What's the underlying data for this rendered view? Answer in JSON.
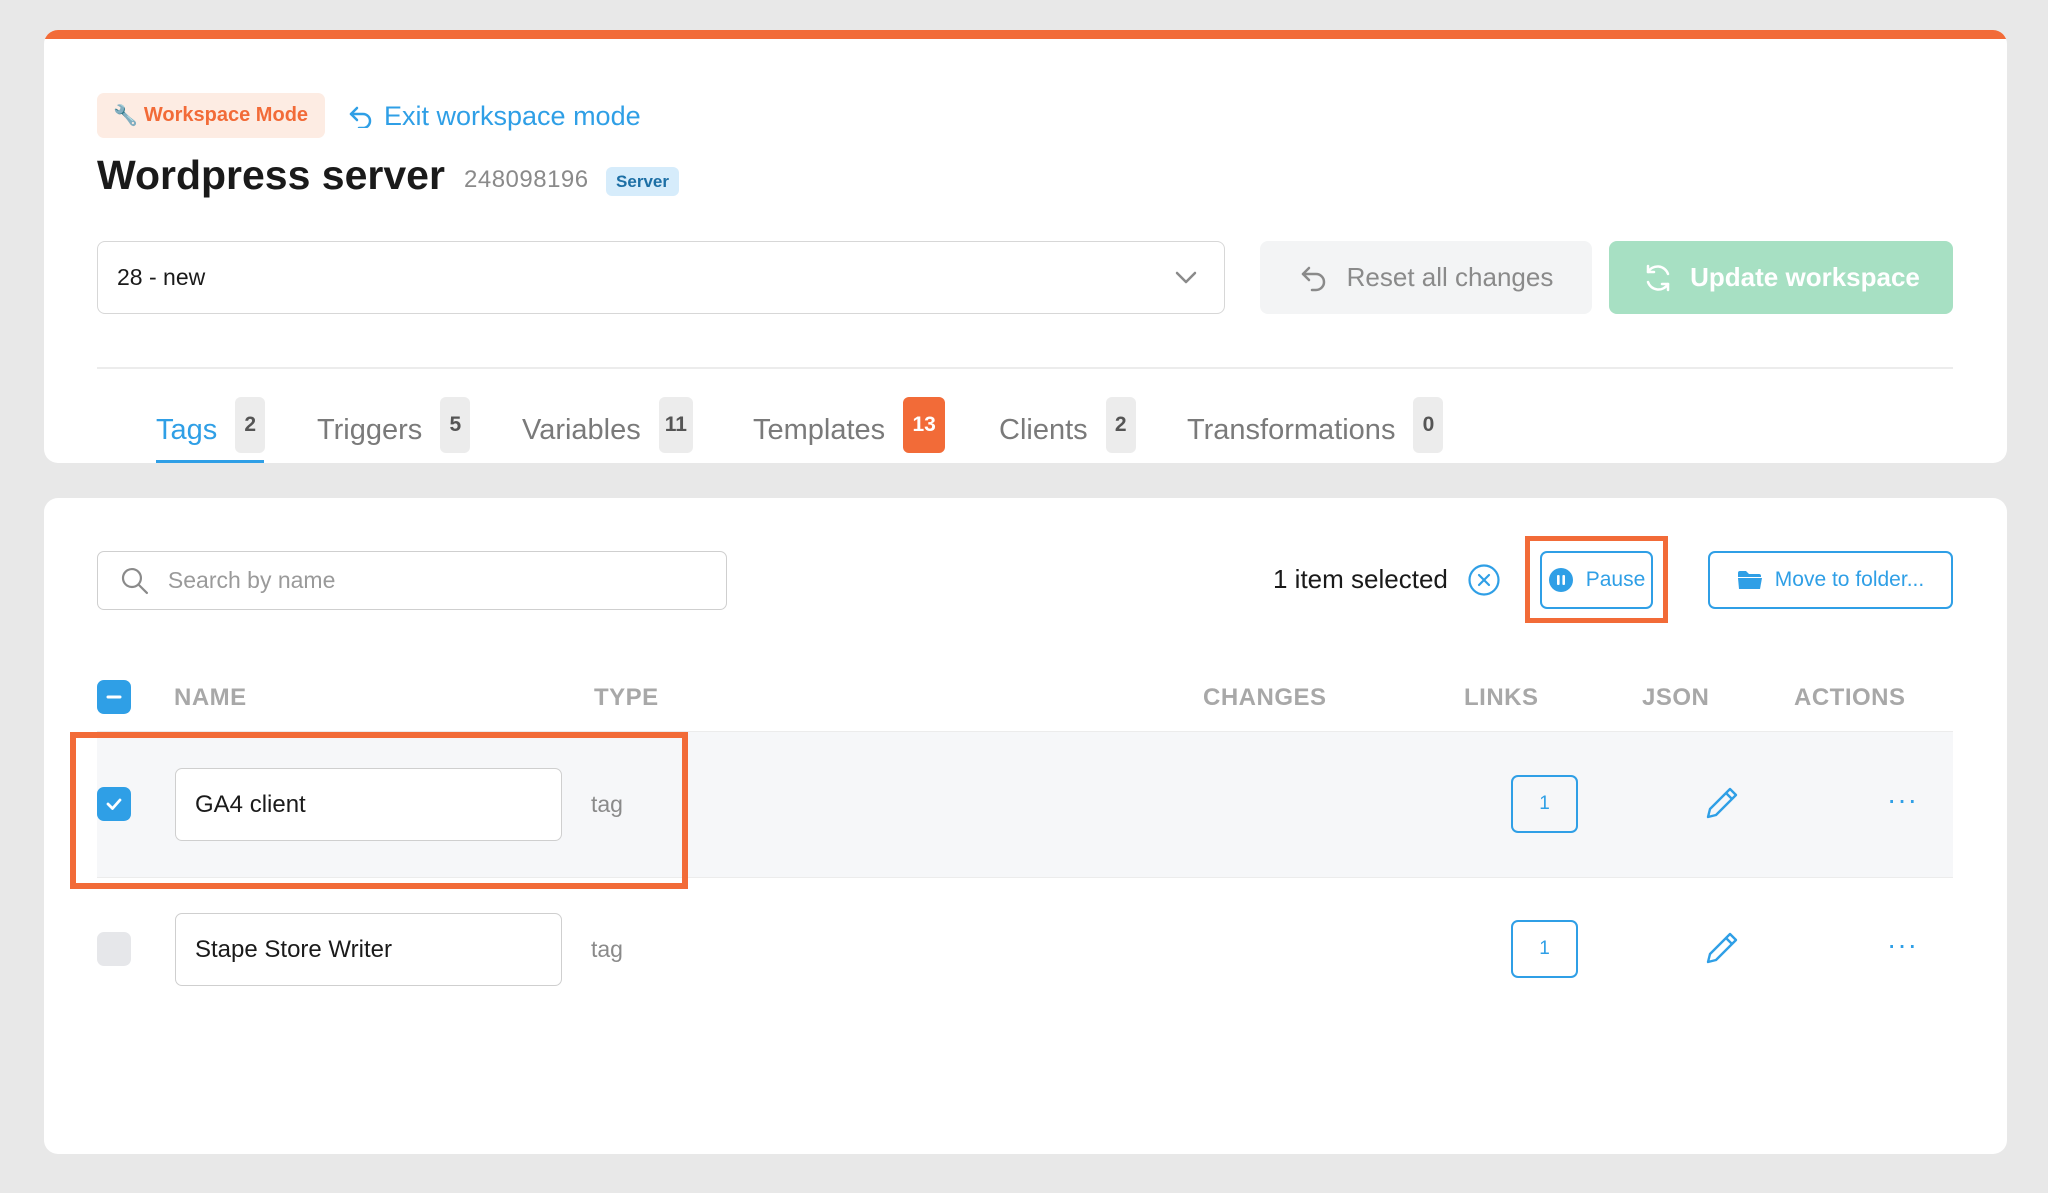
{
  "header": {
    "workspace_mode_label": "Workspace Mode",
    "exit_label": "Exit workspace mode",
    "title": "Wordpress server",
    "container_id": "248098196",
    "container_type": "Server"
  },
  "workspace_select": {
    "value": "28 - new"
  },
  "buttons": {
    "reset": "Reset all changes",
    "update": "Update workspace",
    "pause": "Pause",
    "move": "Move to folder..."
  },
  "tabs": [
    {
      "label": "Tags",
      "count": "2",
      "active": true
    },
    {
      "label": "Triggers",
      "count": "5"
    },
    {
      "label": "Variables",
      "count": "11"
    },
    {
      "label": "Templates",
      "count": "13",
      "highlight": true
    },
    {
      "label": "Clients",
      "count": "2"
    },
    {
      "label": "Transformations",
      "count": "0"
    }
  ],
  "search": {
    "placeholder": "Search by name"
  },
  "selection": {
    "text": "1 item selected"
  },
  "table": {
    "headers": {
      "name": "NAME",
      "type": "TYPE",
      "changes": "CHANGES",
      "links": "LINKS",
      "json": "JSON",
      "actions": "ACTIONS"
    },
    "rows": [
      {
        "name": "GA4 client",
        "type": "tag",
        "links": "1",
        "selected": true
      },
      {
        "name": "Stape Store Writer",
        "type": "tag",
        "links": "1",
        "selected": false
      }
    ],
    "actions_glyph": "···"
  },
  "colors": {
    "accent": "#2f9fe6",
    "brand_orange": "#f26b38",
    "update_green": "#a7e0c3"
  }
}
